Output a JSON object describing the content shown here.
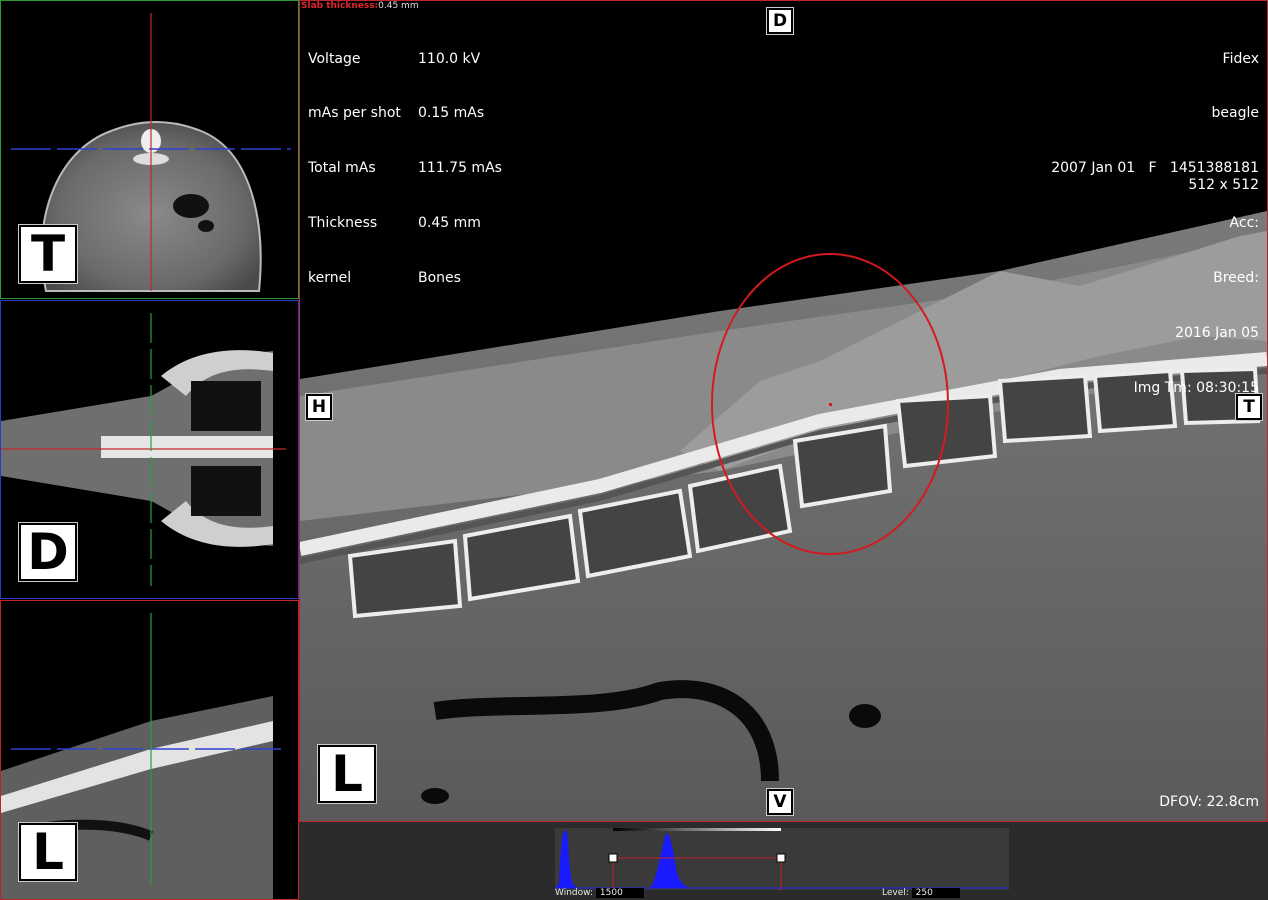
{
  "slab": {
    "label": "Slab thickness:",
    "value": "0.45 mm"
  },
  "acquisition": [
    {
      "key": "Voltage",
      "value": "110.0 kV"
    },
    {
      "key": "mAs per shot",
      "value": "0.15 mAs"
    },
    {
      "key": "Total mAs",
      "value": "111.75 mAs"
    },
    {
      "key": "Thickness",
      "value": "0.45 mm"
    },
    {
      "key": "kernel",
      "value": "Bones"
    }
  ],
  "patient": {
    "name": "Fidex",
    "breed_name": "beagle",
    "birth_sex_id": "2007 Jan 01   F   1451388181",
    "acc": "Acc:",
    "breed": "Breed:",
    "study_date": "2016 Jan 05",
    "img_time": "Img Tm: 08:30:15",
    "matrix": "512 x 512"
  },
  "dfov": "DFOV: 22.8cm",
  "orientation": {
    "top": "D",
    "bottom": "V",
    "left": "H",
    "right": "T"
  },
  "views": {
    "axial": "T",
    "dorsal": "D",
    "lateral": "L",
    "main": "L"
  },
  "window": {
    "label": "Window:",
    "value": "1500"
  },
  "level": {
    "label": "Level:",
    "value": "250"
  },
  "colors": {
    "axial_border": "#2f9a3a",
    "dorsal_border": "#2a3cc4",
    "lateral_border": "#c0232a",
    "histogram": "#1a1aff",
    "roi": "#d41a1f"
  }
}
